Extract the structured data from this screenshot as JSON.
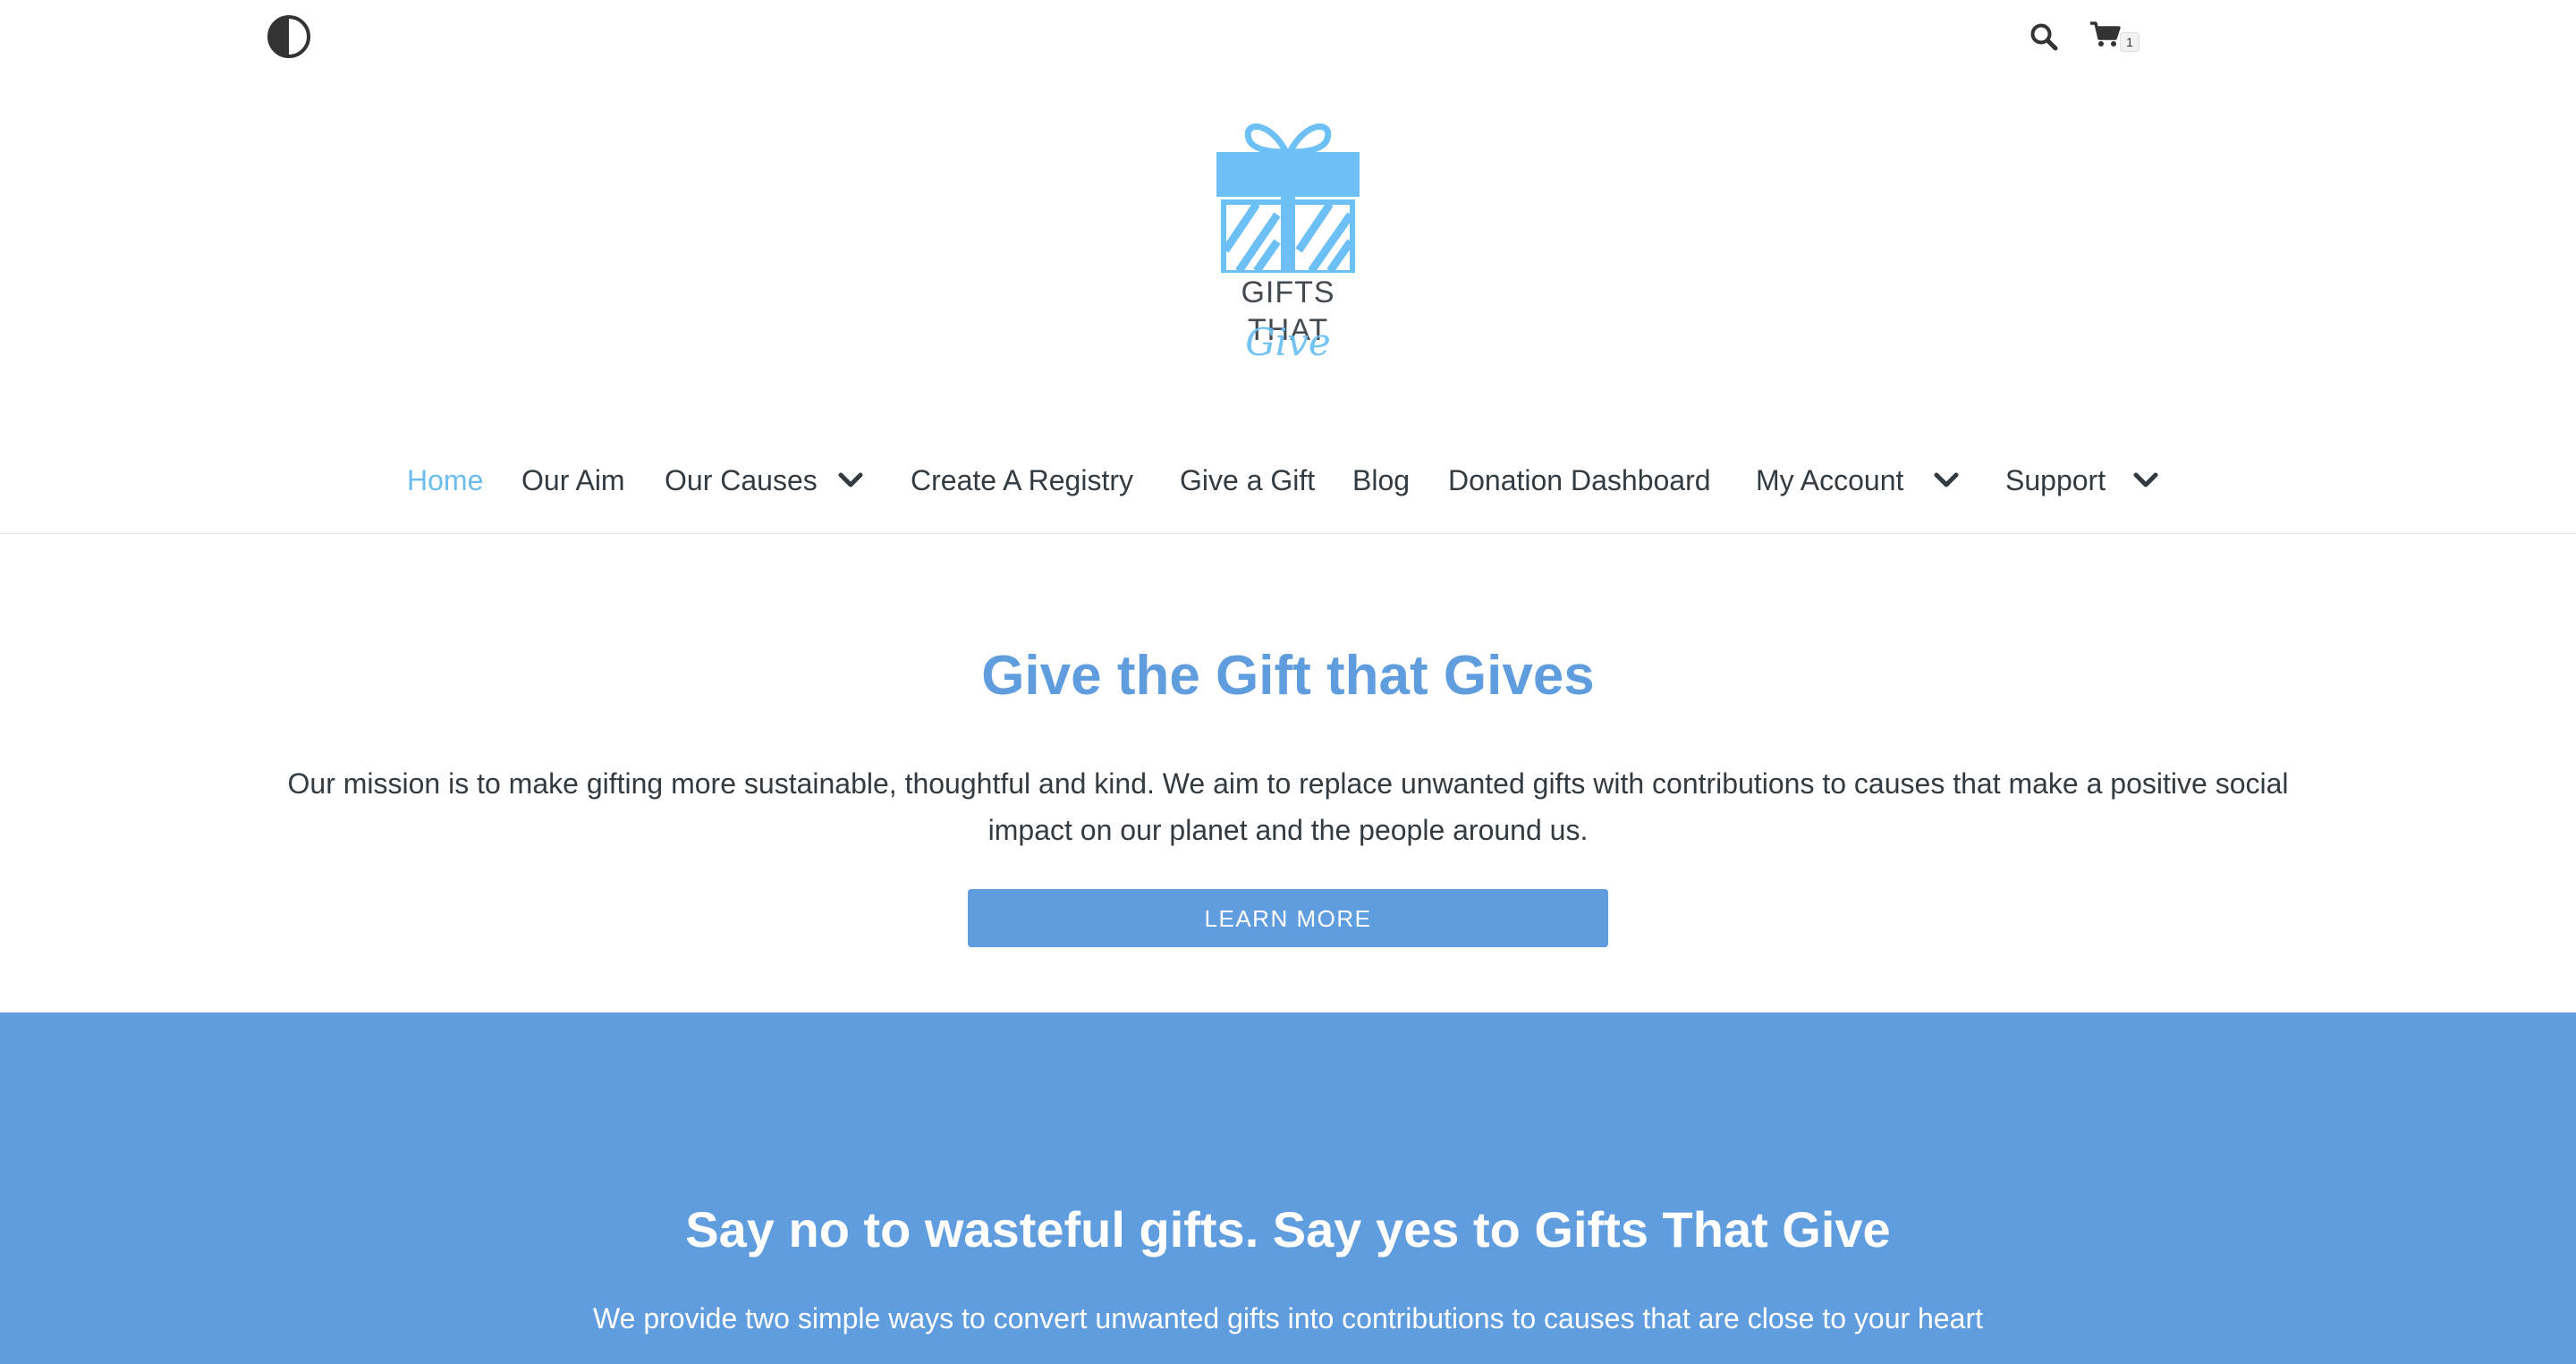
{
  "header": {
    "cart_count": "1",
    "logo": {
      "line1": "GIFTS",
      "line2": "THAT",
      "script": "Give"
    }
  },
  "nav": {
    "home": "Home",
    "our_aim": "Our Aim",
    "our_causes": "Our Causes",
    "create_registry": "Create A Registry",
    "give_gift": "Give a Gift",
    "blog": "Blog",
    "donation_dashboard": "Donation Dashboard",
    "my_account": "My Account",
    "support": "Support"
  },
  "icons": {
    "contrast": "contrast-icon",
    "search": "search-icon",
    "cart": "cart-icon",
    "dropdown": "chevron-down-icon"
  },
  "hero": {
    "title": "Give the Gift that Gives",
    "text": "Our mission is to make gifting more sustainable, thoughtful and kind. We aim to replace unwanted gifts with contributions to causes that make a positive social impact on our planet and the people around us.",
    "button": "LEARN MORE"
  },
  "blue_section": {
    "title": "Say no to wasteful gifts. Say yes to Gifts That Give",
    "text": "We provide two simple ways to convert unwanted gifts into contributions to causes that are close to your heart"
  },
  "colors": {
    "accent": "#5f9ddf",
    "nav_active": "#6cbcec",
    "logo_blue": "#6cc0f5",
    "text": "#333a40"
  }
}
